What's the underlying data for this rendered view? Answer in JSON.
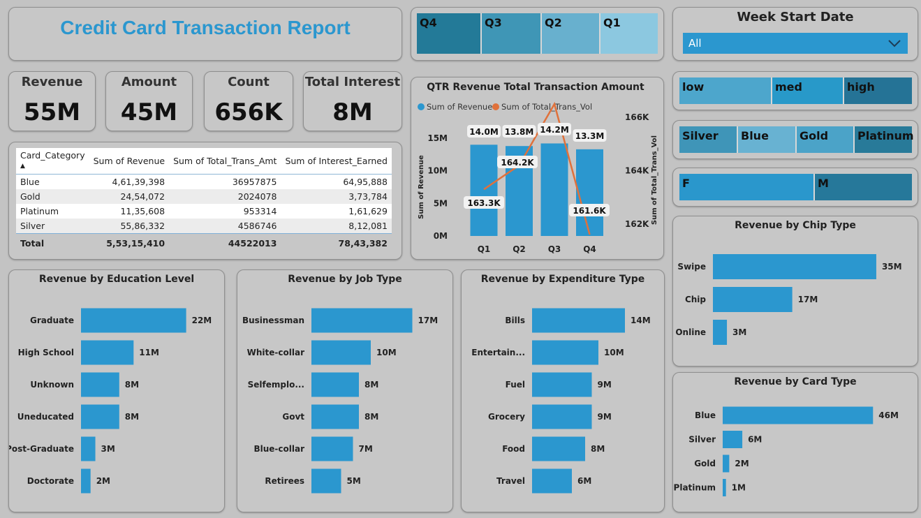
{
  "report": {
    "title": "Credit Card Transaction Report"
  },
  "kpis": [
    {
      "label": "Revenue",
      "value": "55M"
    },
    {
      "label": "Amount",
      "value": "45M"
    },
    {
      "label": "Count",
      "value": "656K"
    },
    {
      "label": "Total Interest",
      "value": "8M"
    }
  ],
  "quarter_slicer": {
    "items": [
      {
        "label": "Q4",
        "color": "#237a98"
      },
      {
        "label": "Q3",
        "color": "#3f96b6"
      },
      {
        "label": "Q2",
        "color": "#68b0ce"
      },
      {
        "label": "Q1",
        "color": "#8cc8e0"
      }
    ]
  },
  "week_slicer": {
    "title": "Week Start Date",
    "selected": "All"
  },
  "income_slicer": {
    "items": [
      {
        "label": "low",
        "color": "#4da6cc"
      },
      {
        "label": "med",
        "color": "#2899c9"
      },
      {
        "label": "high",
        "color": "#257396"
      }
    ]
  },
  "card_slicer": {
    "items": [
      {
        "label": "Silver",
        "color": "#3f95b8"
      },
      {
        "label": "Blue",
        "color": "#68b2d2"
      },
      {
        "label": "Gold",
        "color": "#4ba3c8"
      },
      {
        "label": "Platinum",
        "color": "#287a99"
      }
    ]
  },
  "gender_slicer": {
    "items": [
      {
        "label": "F",
        "color": "#2a97cc"
      },
      {
        "label": "M",
        "color": "#26789a"
      }
    ]
  },
  "matrix": {
    "headers": [
      "Card_Category",
      "Sum of Revenue",
      "Sum of Total_Trans_Amt",
      "Sum of Interest_Earned"
    ],
    "sort_indicator": "▲",
    "rows": [
      [
        "Blue",
        "4,61,39,398",
        "36957875",
        "64,95,888"
      ],
      [
        "Gold",
        "24,54,072",
        "2024078",
        "3,73,784"
      ],
      [
        "Platinum",
        "11,35,608",
        "953314",
        "1,61,629"
      ],
      [
        "Silver",
        "55,86,332",
        "4586746",
        "8,12,081"
      ]
    ],
    "total": [
      "Total",
      "5,53,15,410",
      "44522013",
      "78,43,382"
    ]
  },
  "charts": {
    "qtr": {
      "title": "QTR Revenue Total Transaction Amount",
      "legend": [
        "Sum of Revenue",
        "Sum of Total_Trans_Vol"
      ],
      "y_left_label": "Sum of Revenue",
      "y_right_label": "Sum of Total_Trans_Vol",
      "y_left_ticks": [
        "0M",
        "5M",
        "10M",
        "15M"
      ],
      "y_right_ticks": [
        "162K",
        "164K",
        "166K"
      ],
      "bar_labels": [
        "14.0M",
        "13.8M",
        "14.2M",
        "13.3M"
      ],
      "line_labels": [
        "163.3K",
        "164.2K",
        "",
        "161.6K"
      ]
    },
    "education": {
      "title": "Revenue by Education Level"
    },
    "job": {
      "title": "Revenue by Job Type"
    },
    "expenditure": {
      "title": "Revenue by Expenditure Type"
    },
    "chip": {
      "title": "Revenue by Chip Type"
    },
    "card": {
      "title": "Revenue by Card Type"
    }
  },
  "chart_data": [
    {
      "type": "bar",
      "title": "QTR Revenue Total Transaction Amount",
      "categories": [
        "Q1",
        "Q2",
        "Q3",
        "Q4"
      ],
      "series": [
        {
          "name": "Sum of Revenue",
          "values": [
            14.0,
            13.8,
            14.2,
            13.3
          ],
          "unit": "M",
          "color": "#2b97cf",
          "kind": "bar",
          "axis": "left"
        },
        {
          "name": "Sum of Total_Trans_Vol",
          "values": [
            163.3,
            164.2,
            166.5,
            161.6
          ],
          "unit": "K",
          "color": "#e0713b",
          "kind": "line",
          "axis": "right"
        }
      ],
      "ylabel": "Sum of Revenue",
      "ylim": [
        0,
        17
      ],
      "y2label": "Sum of Total_Trans_Vol",
      "y2lim": [
        161,
        166.5
      ],
      "legend": "top-left"
    },
    {
      "type": "bar",
      "title": "Revenue by Education Level",
      "orientation": "horizontal",
      "categories": [
        "Graduate",
        "High School",
        "Unknown",
        "Uneducated",
        "Post-Graduate",
        "Doctorate"
      ],
      "values": [
        22,
        11,
        8,
        8,
        3,
        2
      ],
      "labels": [
        "22M",
        "11M",
        "8M",
        "8M",
        "3M",
        "2M"
      ],
      "unit": "M",
      "xlim": [
        0,
        26
      ]
    },
    {
      "type": "bar",
      "title": "Revenue by Job Type",
      "orientation": "horizontal",
      "categories": [
        "Businessman",
        "White-collar",
        "Selfemplo...",
        "Govt",
        "Blue-collar",
        "Retirees"
      ],
      "values": [
        17,
        10,
        8,
        8,
        7,
        5
      ],
      "labels": [
        "17M",
        "10M",
        "8M",
        "8M",
        "7M",
        "5M"
      ],
      "unit": "M",
      "xlim": [
        0,
        20
      ]
    },
    {
      "type": "bar",
      "title": "Revenue by Expenditure Type",
      "orientation": "horizontal",
      "categories": [
        "Bills",
        "Entertain...",
        "Fuel",
        "Grocery",
        "Food",
        "Travel"
      ],
      "values": [
        14,
        10,
        9,
        9,
        8,
        6
      ],
      "labels": [
        "14M",
        "10M",
        "9M",
        "9M",
        "8M",
        "6M"
      ],
      "unit": "M",
      "xlim": [
        0,
        16
      ]
    },
    {
      "type": "bar",
      "title": "Revenue by Chip Type",
      "orientation": "horizontal",
      "categories": [
        "Swipe",
        "Chip",
        "Online"
      ],
      "values": [
        35,
        17,
        3
      ],
      "labels": [
        "35M",
        "17M",
        "3M"
      ],
      "unit": "M",
      "xlim": [
        0,
        38
      ]
    },
    {
      "type": "bar",
      "title": "Revenue by Card Type",
      "orientation": "horizontal",
      "categories": [
        "Blue",
        "Silver",
        "Gold",
        "Platinum"
      ],
      "values": [
        46,
        6,
        2,
        1
      ],
      "labels": [
        "46M",
        "6M",
        "2M",
        "1M"
      ],
      "unit": "M",
      "xlim": [
        0,
        50
      ]
    }
  ],
  "colors": {
    "bar": "#2b97cf",
    "line": "#e0713b",
    "title": "#2b97cf"
  }
}
